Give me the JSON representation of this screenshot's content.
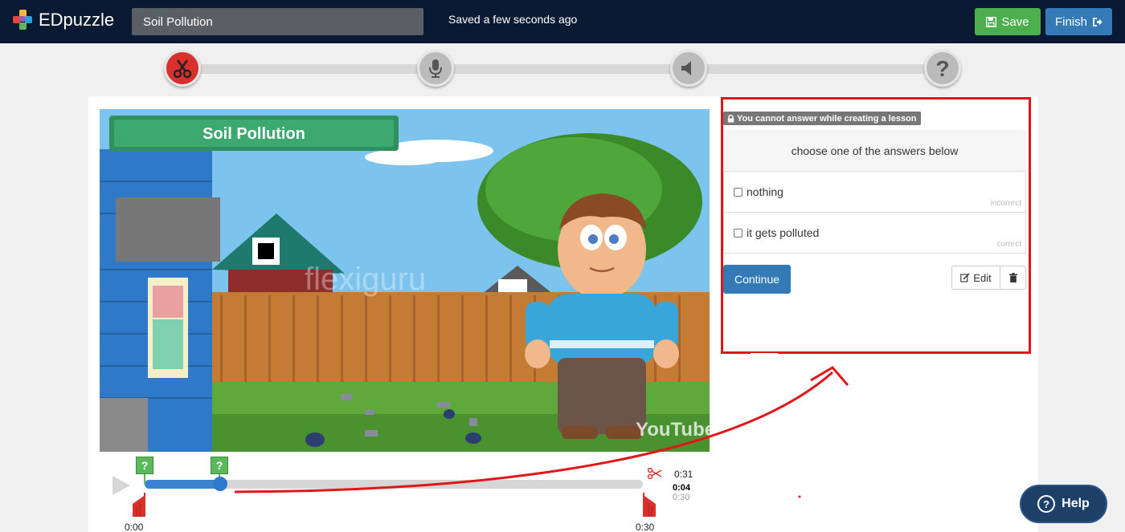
{
  "app": {
    "name": "EDpuzzle"
  },
  "header": {
    "title_value": "Soil Pollution",
    "saved_status": "Saved a few seconds ago",
    "save_label": "Save",
    "finish_label": "Finish"
  },
  "steps": [
    {
      "name": "cut",
      "icon": "scissors-icon",
      "active": true
    },
    {
      "name": "voiceover",
      "icon": "microphone-icon",
      "active": false
    },
    {
      "name": "audio-notes",
      "icon": "speaker-icon",
      "active": false
    },
    {
      "name": "quiz",
      "icon": "question-icon",
      "active": false
    }
  ],
  "video": {
    "title_banner": "Soil Pollution",
    "watermark": "flexiguru",
    "brand": "YouTube"
  },
  "timeline": {
    "start_label": "0:00",
    "end_label": "0:30",
    "total_duration": "0:31",
    "current_time": "0:04",
    "trimmed_duration": "0:30",
    "progress_fraction": 0.13,
    "question_markers": [
      "?",
      "?"
    ]
  },
  "question": {
    "lock_notice": "You cannot answer while creating a lesson",
    "prompt": "choose one of the answers below",
    "answers": [
      {
        "label": "nothing",
        "status": "incorrect"
      },
      {
        "label": "it gets polluted",
        "status": "correct"
      }
    ],
    "continue_label": "Continue",
    "edit_label": "Edit"
  },
  "help": {
    "label": "Help"
  },
  "colors": {
    "topbar": "#0b1a33",
    "save": "#4cae4c",
    "finish": "#337ab7",
    "active_step": "#d9302c",
    "annotation": "#e0161b",
    "help": "#1e3f66"
  }
}
